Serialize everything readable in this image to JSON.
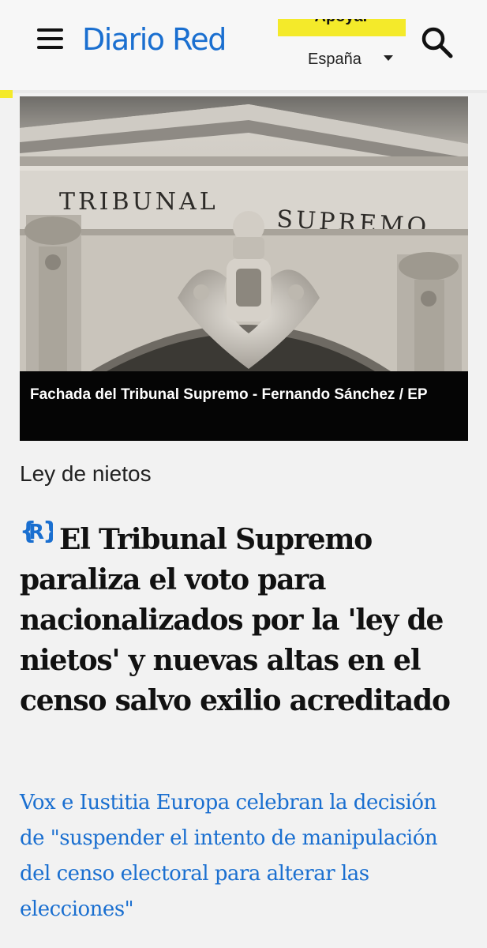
{
  "header": {
    "logo": "Diario Red",
    "support_label": "Apoyar",
    "country": "España"
  },
  "article": {
    "image_caption": "Fachada del Tribunal Supremo - Fernando Sánchez / EP",
    "image_text_left": "TRIBUNAL",
    "image_text_right": "SUPREMO",
    "category": "Ley de nietos",
    "headline": "El Tribunal Supremo paraliza el voto para nacionalizados por la 'ley de nietos' y nuevas altas en el censo salvo exilio acreditado",
    "subheadline": "Vox e Iustitia Europa celebran la decisión de \"suspender el intento de manipulación del censo electoral para alterar las elecciones\""
  },
  "colors": {
    "brand_blue": "#1a6fd0",
    "support_yellow": "#f4ea2a",
    "background": "#f2f2f2"
  },
  "icons": {
    "menu": "hamburger-menu-icon",
    "search": "search-icon",
    "dropdown": "chevron-down-icon",
    "premium": "r-badge-icon"
  }
}
